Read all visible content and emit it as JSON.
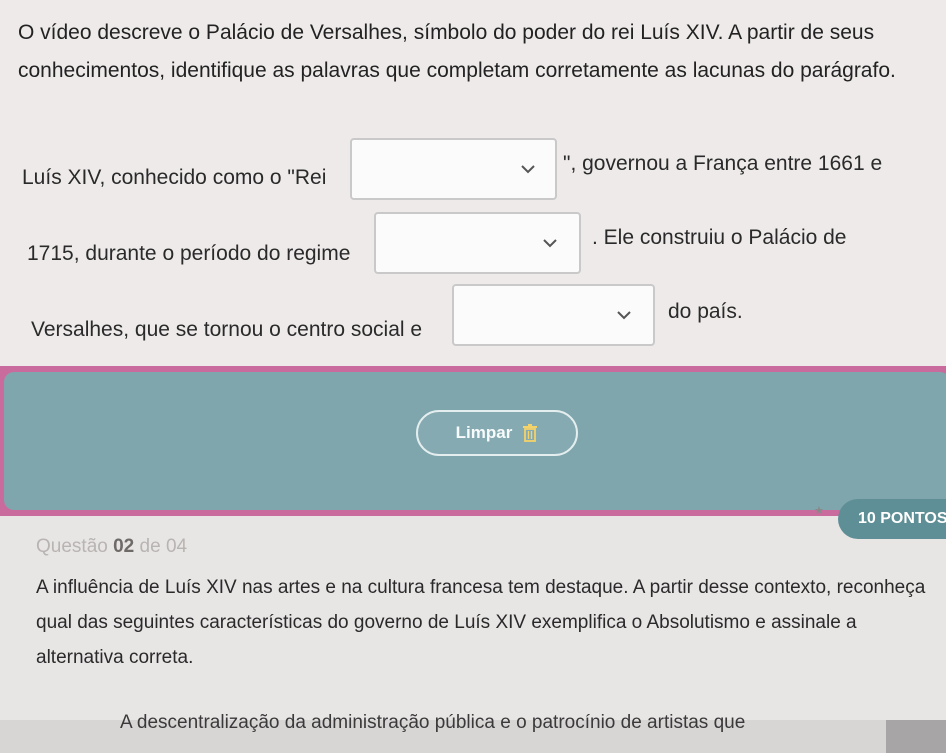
{
  "intro": "O vídeo descreve o Palácio de Versalhes, símbolo do poder do rei Luís XIV. A partir de seus conhecimentos, identifique as palavras que completam corretamente as lacunas do parágrafo.",
  "paragraph": {
    "line1_before": "Luís XIV, conhecido como o \"Rei",
    "line1_after": "\", governou a França entre 1661 e",
    "line2_before": "1715, durante o período do regime",
    "line2_after": ". Ele construiu o Palácio de",
    "line3_before": "Versalhes, que se tornou o centro social e",
    "line3_after": "do país."
  },
  "dropdowns": [
    {
      "value": ""
    },
    {
      "value": ""
    },
    {
      "value": ""
    }
  ],
  "clear_button": {
    "label": "Limpar",
    "icon": "trash-icon"
  },
  "question": {
    "label_prefix": "Questão",
    "number": "02",
    "label_suffix": "de 04",
    "points": "10 PONTOS",
    "text": "A influência de Luís XIV nas artes e na cultura francesa tem destaque. A partir desse contexto, reconheça qual das seguintes características do governo de Luís XIV exemplifica o Absolutismo e assinale a alternativa correta.",
    "option_a": "A descentralização da administração pública e o patrocínio de artistas que"
  },
  "colors": {
    "accent_teal": "#7fa5ad",
    "band_pink": "#c96c9d",
    "badge": "#5f8f96"
  }
}
